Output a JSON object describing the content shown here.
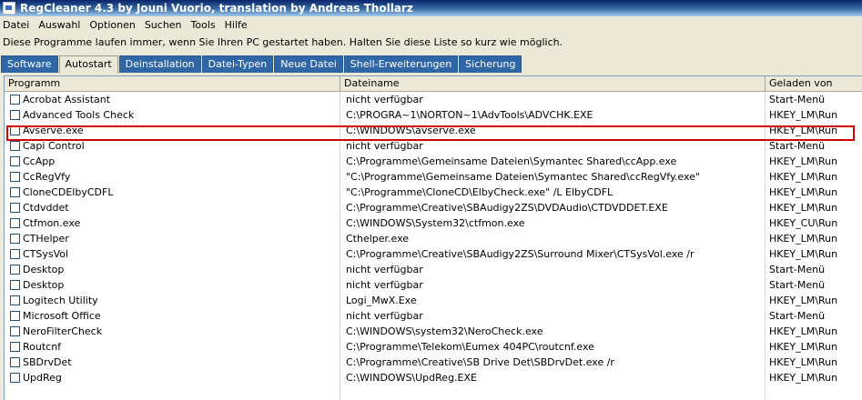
{
  "window": {
    "title": "RegCleaner 4.3 by Jouni Vuorio, translation by Andreas Thollarz"
  },
  "menu": [
    "Datei",
    "Auswahl",
    "Optionen",
    "Suchen",
    "Tools",
    "Hilfe"
  ],
  "info_text": "Diese Programme laufen immer, wenn Sie Ihren PC gestartet haben. Halten Sie diese Liste so kurz wie möglich.",
  "tabs": [
    {
      "label": "Software",
      "active": false
    },
    {
      "label": "Autostart",
      "active": true
    },
    {
      "label": "Deinstallation",
      "active": false
    },
    {
      "label": "Datei-Typen",
      "active": false
    },
    {
      "label": "Neue Datei",
      "active": false
    },
    {
      "label": "Shell-Erweiterungen",
      "active": false
    },
    {
      "label": "Sicherung",
      "active": false
    }
  ],
  "columns": [
    "Programm",
    "Dateiname",
    "Geladen von"
  ],
  "rows": [
    {
      "programm": "Acrobat Assistant",
      "dateiname": "nicht verfügbar",
      "geladen": "Start-Menü",
      "checked": false
    },
    {
      "programm": "Advanced Tools Check",
      "dateiname": "C:\\PROGRA~1\\NORTON~1\\AdvTools\\ADVCHK.EXE",
      "geladen": "HKEY_LM\\Run",
      "checked": false
    },
    {
      "programm": "Avserve.exe",
      "dateiname": "C:\\WINDOWS\\avserve.exe",
      "geladen": "HKEY_LM\\Run",
      "checked": false,
      "highlighted": true
    },
    {
      "programm": "Capi Control",
      "dateiname": "nicht verfügbar",
      "geladen": "Start-Menü",
      "checked": false
    },
    {
      "programm": "CcApp",
      "dateiname": "C:\\Programme\\Gemeinsame Dateien\\Symantec Shared\\ccApp.exe",
      "geladen": "HKEY_LM\\Run",
      "checked": false
    },
    {
      "programm": "CcRegVfy",
      "dateiname": "\"C:\\Programme\\Gemeinsame Dateien\\Symantec Shared\\ccRegVfy.exe\"",
      "geladen": "HKEY_LM\\Run",
      "checked": false
    },
    {
      "programm": "CloneCDElbyCDFL",
      "dateiname": "\"C:\\Programme\\CloneCD\\ElbyCheck.exe\" /L ElbyCDFL",
      "geladen": "HKEY_LM\\Run",
      "checked": false
    },
    {
      "programm": "Ctdvddet",
      "dateiname": "C:\\Programme\\Creative\\SBAudigy2ZS\\DVDAudio\\CTDVDDET.EXE",
      "geladen": "HKEY_LM\\Run",
      "checked": false
    },
    {
      "programm": "Ctfmon.exe",
      "dateiname": "C:\\WINDOWS\\System32\\ctfmon.exe",
      "geladen": "HKEY_CU\\Run",
      "checked": false
    },
    {
      "programm": "CTHelper",
      "dateiname": "Cthelper.exe",
      "geladen": "HKEY_LM\\Run",
      "checked": false
    },
    {
      "programm": "CTSysVol",
      "dateiname": "C:\\Programme\\Creative\\SBAudigy2ZS\\Surround Mixer\\CTSysVol.exe /r",
      "geladen": "HKEY_LM\\Run",
      "checked": false
    },
    {
      "programm": "Desktop",
      "dateiname": "nicht verfügbar",
      "geladen": "Start-Menü",
      "checked": false
    },
    {
      "programm": "Desktop",
      "dateiname": "nicht verfügbar",
      "geladen": "Start-Menü",
      "checked": false
    },
    {
      "programm": "Logitech Utility",
      "dateiname": "Logi_MwX.Exe",
      "geladen": "HKEY_LM\\Run",
      "checked": false
    },
    {
      "programm": "Microsoft Office",
      "dateiname": "nicht verfügbar",
      "geladen": "Start-Menü",
      "checked": false
    },
    {
      "programm": "NeroFilterCheck",
      "dateiname": "C:\\WINDOWS\\system32\\NeroCheck.exe",
      "geladen": "HKEY_LM\\Run",
      "checked": false
    },
    {
      "programm": "Routcnf",
      "dateiname": "C:\\Programme\\Telekom\\Eumex 404PC\\routcnf.exe",
      "geladen": "HKEY_LM\\Run",
      "checked": false
    },
    {
      "programm": "SBDrvDet",
      "dateiname": "C:\\Programme\\Creative\\SB Drive Det\\SBDrvDet.exe /r",
      "geladen": "HKEY_LM\\Run",
      "checked": false
    },
    {
      "programm": "UpdReg",
      "dateiname": "C:\\WINDOWS\\UpdReg.EXE",
      "geladen": "HKEY_LM\\Run",
      "checked": false
    }
  ]
}
